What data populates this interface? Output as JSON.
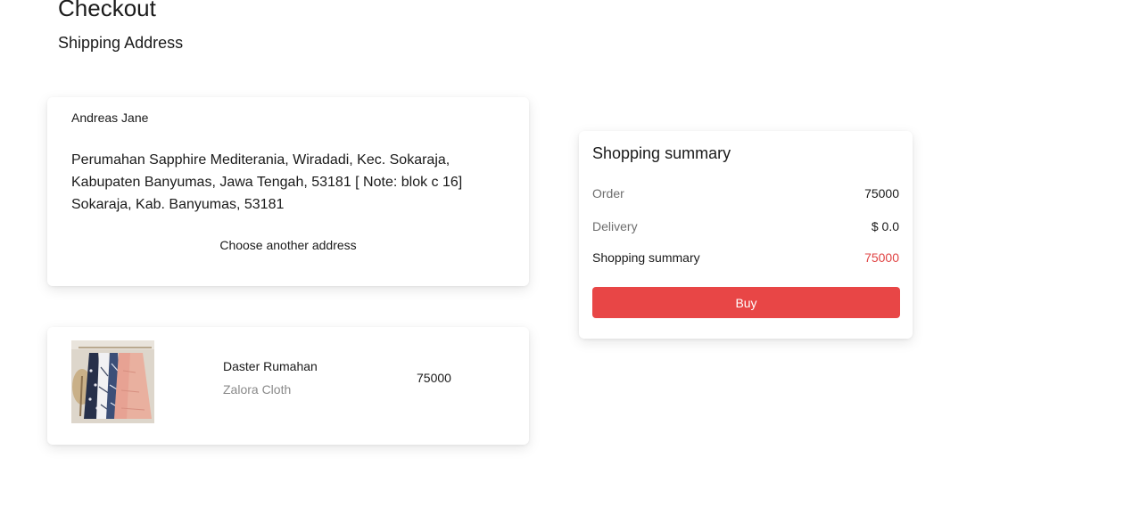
{
  "header": {
    "title": "Checkout",
    "subtitle": "Shipping Address"
  },
  "address": {
    "name": "Andreas Jane",
    "full_address": "Perumahan Sapphire Mediterania, Wiradadi, Kec. Sokaraja, Kabupaten Banyumas, Jawa Tengah, 53181 [ Note: blok c 16] Sokaraja, Kab. Banyumas, 53181",
    "change_label": "Choose another address"
  },
  "product": {
    "name": "Daster Rumahan",
    "brand": "Zalora Cloth",
    "price": "75000",
    "image_icon": "product-photo-dresses"
  },
  "summary": {
    "title": "Shopping summary",
    "order_label": "Order",
    "order_value": "75000",
    "delivery_label": "Delivery",
    "delivery_value": "$ 0.0",
    "total_label": "Shopping summary",
    "total_value": "75000",
    "buy_label": "Buy"
  },
  "colors": {
    "accent": "#e84646",
    "total_text": "#e04444",
    "muted_text": "#8a8a8a"
  }
}
